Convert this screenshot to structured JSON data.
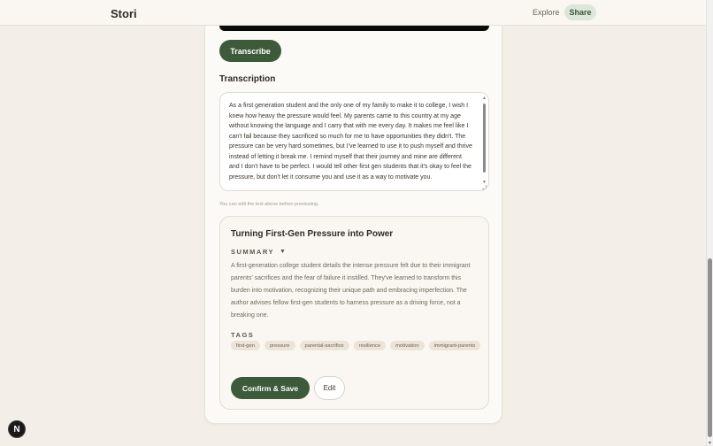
{
  "header": {
    "brand": "Stori",
    "nav_explore": "Explore",
    "nav_share": "Share"
  },
  "main": {
    "transcribe_label": "Transcribe",
    "transcription_heading": "Transcription",
    "transcription_text": "As a first generation student and the only one of my family to make it to college, I wish I knew how heavy the pressure would feel. My parents came to this country at my age without knowing the language and I carry that with me every day. It makes me feel like I can't fail because they sacrificed so much for me to have opportunities they didn't. The pressure can be very hard sometimes, but I've learned to use it to push myself and thrive instead of letting it break me. I remind myself that their journey and mine are different and I don't have to be perfect. I would tell other first gen students that it's okay to feel the pressure, but don't let it consume you and use it as a way to motivate you.",
    "helper_text": "You can edit the text above before previewing."
  },
  "preview": {
    "title": "Turning First-Gen Pressure into Power",
    "summary_label": "SUMMARY",
    "summary_caret": "▼",
    "summary_text": "A first-generation college student details the intense pressure felt due to their immigrant parents' sacrifices and the fear of failure it instilled. They've learned to transform this burden into motivation, recognizing their unique path and embracing imperfection. The author advises fellow first-gen students to harness pressure as a driving force, not a breaking one.",
    "tags_label": "TAGS",
    "tags": [
      "first-gen",
      "pressure",
      "parental-sacrifice",
      "resilience",
      "motivation",
      "immigrant-parents"
    ],
    "confirm_label": "Confirm & Save",
    "edit_label": "Edit"
  },
  "dev_badge": "N",
  "colors": {
    "accent": "#3d5a3a",
    "background": "#f3efe8",
    "card": "#fcfaf6"
  }
}
